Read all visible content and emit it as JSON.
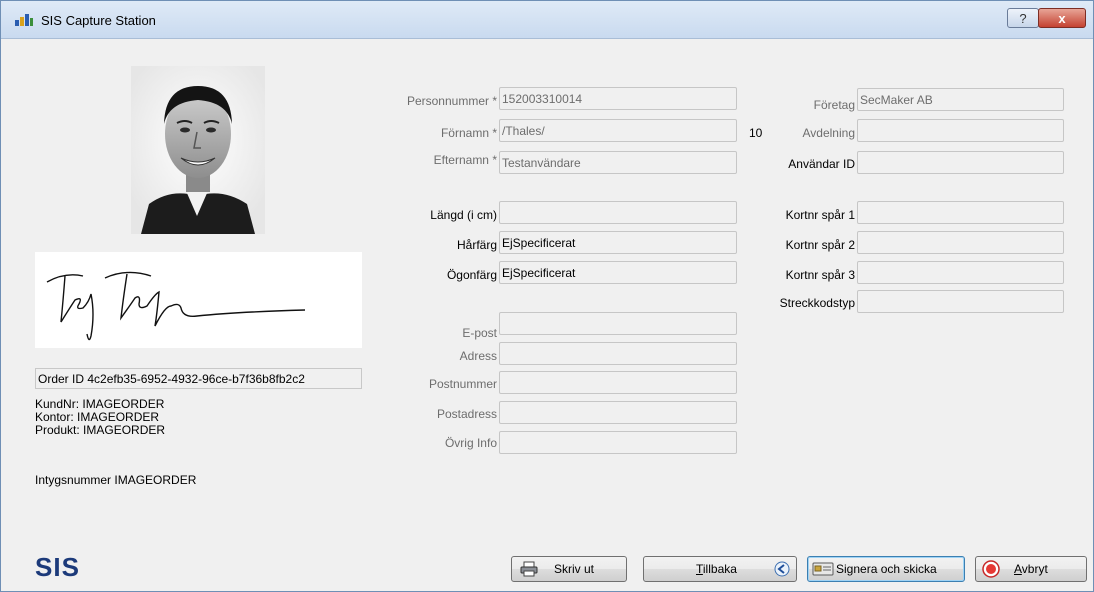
{
  "window": {
    "title": "SIS Capture Station",
    "help_glyph": "?",
    "close_glyph": "x",
    "icons": {
      "app": "sis-app-icon",
      "help": "help-icon",
      "close": "close-icon"
    }
  },
  "left": {
    "order_id_label": "Order ID",
    "order_id_value": "4c2efb35-6952-4932-96ce-b7f36b8fb2c2",
    "kundnr": "KundNr: IMAGEORDER",
    "kontor": "Kontor: IMAGEORDER",
    "produkt": "Produkt: IMAGEORDER",
    "intyg_label": "Intygsnummer",
    "intyg_value": "IMAGEORDER",
    "signature_text": "Test Testan",
    "logo": "SIS"
  },
  "form": {
    "personnummer": {
      "label": "Personnummer *",
      "value": "152003310014"
    },
    "fornamn": {
      "label": "Förnamn *",
      "value": "/Thales/"
    },
    "fornamn_count": "10",
    "efternamn": {
      "label": "Efternamn *",
      "value": "Testanvändare"
    },
    "langd": {
      "label": "Längd (i cm)",
      "value": ""
    },
    "harfarg": {
      "label": "Hårfärg",
      "value": "EjSpecificerat"
    },
    "ogonfarg": {
      "label": "Ögonfärg",
      "value": "EjSpecificerat"
    },
    "epost": {
      "label": "E-post",
      "value": ""
    },
    "adress": {
      "label": "Adress",
      "value": ""
    },
    "postnummer": {
      "label": "Postnummer",
      "value": ""
    },
    "postadress": {
      "label": "Postadress",
      "value": ""
    },
    "ovrig": {
      "label": "Övrig Info",
      "value": ""
    },
    "foretag": {
      "label": "Företag",
      "value": "SecMaker AB"
    },
    "avdelning": {
      "label": "Avdelning",
      "value": ""
    },
    "anvandar_id": {
      "label": "Användar ID",
      "value": ""
    },
    "kort1": {
      "label": "Kortnr spår 1",
      "value": ""
    },
    "kort2": {
      "label": "Kortnr spår 2",
      "value": ""
    },
    "kort3": {
      "label": "Kortnr spår 3",
      "value": ""
    },
    "streckkod": {
      "label": "Streckkodstyp",
      "value": ""
    }
  },
  "buttons": {
    "print": {
      "label": "Skriv ut",
      "icon": "printer-icon"
    },
    "back": {
      "label_first": "T",
      "label_rest": "illbaka",
      "icon": "back-arrow-icon"
    },
    "sign": {
      "label": "Signera och skicka",
      "icon": "sign-card-icon"
    },
    "cancel": {
      "label_first": "A",
      "label_rest": "vbryt",
      "icon": "stop-icon"
    }
  }
}
